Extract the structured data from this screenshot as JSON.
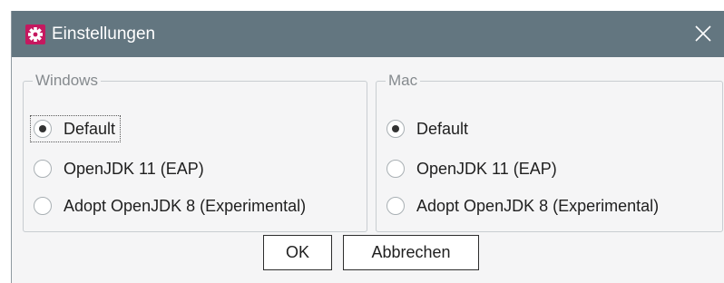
{
  "window": {
    "title": "Einstellungen",
    "app_icon": "gear-icon",
    "close_icon": "close-icon"
  },
  "groups": [
    {
      "legend": "Windows",
      "options": [
        {
          "label": "Default",
          "checked": true,
          "focused": true
        },
        {
          "label": "OpenJDK 11 (EAP)",
          "checked": false,
          "focused": false
        },
        {
          "label": "Adopt OpenJDK 8 (Experimental)",
          "checked": false,
          "focused": false
        }
      ]
    },
    {
      "legend": "Mac",
      "options": [
        {
          "label": "Default",
          "checked": true,
          "focused": false
        },
        {
          "label": "OpenJDK 11 (EAP)",
          "checked": false,
          "focused": false
        },
        {
          "label": "Adopt OpenJDK 8 (Experimental)",
          "checked": false,
          "focused": false
        }
      ]
    }
  ],
  "buttons": {
    "ok_label": "OK",
    "cancel_label": "Abbrechen"
  },
  "colors": {
    "titlebar": "#637680",
    "app_icon_bg": "#c5185f",
    "dialog_bg": "#f5f5f6"
  }
}
